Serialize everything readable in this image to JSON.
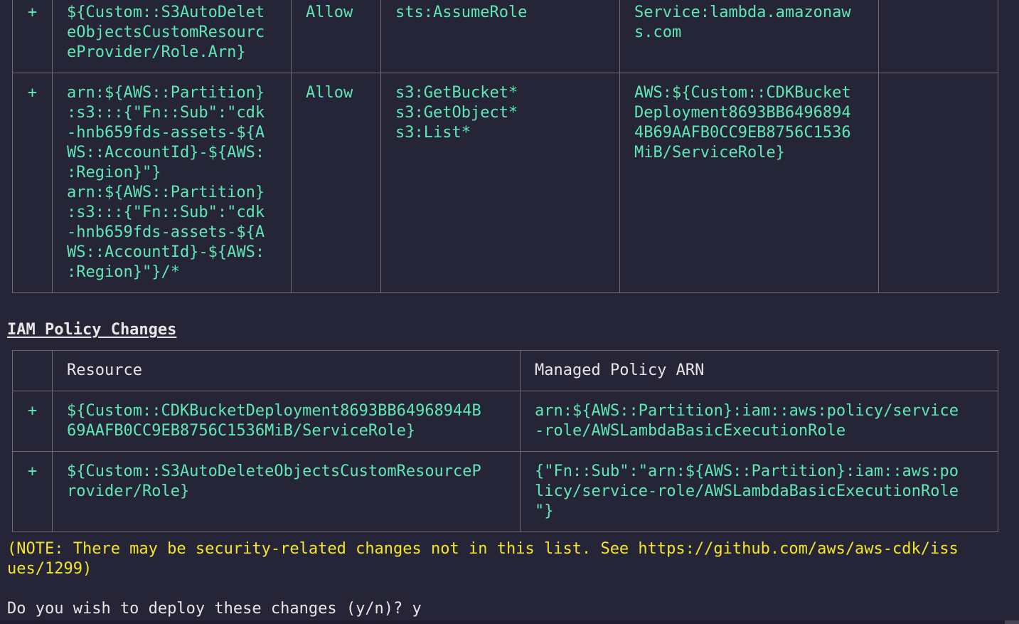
{
  "colors": {
    "background": "#262537",
    "added": "#5ee8b5",
    "note": "#f5e62a",
    "text": "#e6e6e6",
    "border": "#6e6e72"
  },
  "statement_changes": {
    "rows": [
      {
        "sign": "+",
        "resource": "${Custom::S3AutoDelet\neObjectsCustomResourc\neProvider/Role.Arn}",
        "effect": "Allow",
        "action": "sts:AssumeRole",
        "principal": "Service:lambda.amazonaw\ns.com",
        "condition": ""
      },
      {
        "sign": "+",
        "resource": "arn:${AWS::Partition}\n:s3:::{\"Fn::Sub\":\"cdk\n-hnb659fds-assets-${A\nWS::AccountId}-${AWS:\n:Region}\"}\narn:${AWS::Partition}\n:s3:::{\"Fn::Sub\":\"cdk\n-hnb659fds-assets-${A\nWS::AccountId}-${AWS:\n:Region}\"}/*",
        "effect": "Allow",
        "action": "s3:GetBucket*\ns3:GetObject*\ns3:List*",
        "principal": "AWS:${Custom::CDKBucket\nDeployment8693BB6496894\n4B69AAFB0CC9EB8756C1536\nMiB/ServiceRole}",
        "condition": ""
      }
    ]
  },
  "iam_policy_changes": {
    "title": "IAM Policy Changes",
    "headers": [
      "",
      "Resource",
      "Managed Policy ARN"
    ],
    "rows": [
      {
        "sign": "+",
        "resource": "${Custom::CDKBucketDeployment8693BB64968944B\n69AAFB0CC9EB8756C1536MiB/ServiceRole}",
        "arn": "arn:${AWS::Partition}:iam::aws:policy/service\n-role/AWSLambdaBasicExecutionRole"
      },
      {
        "sign": "+",
        "resource": "${Custom::S3AutoDeleteObjectsCustomResourceP\nrovider/Role}",
        "arn": "{\"Fn::Sub\":\"arn:${AWS::Partition}:iam::aws:po\nlicy/service-role/AWSLambdaBasicExecutionRole\n\"}"
      }
    ]
  },
  "note": "(NOTE: There may be security-related changes not in this list. See https://github.com/aws/aws-cdk/iss\nues/1299)",
  "prompt": {
    "question": "Do you wish to deploy these changes (y/n)? ",
    "answer": "y"
  }
}
